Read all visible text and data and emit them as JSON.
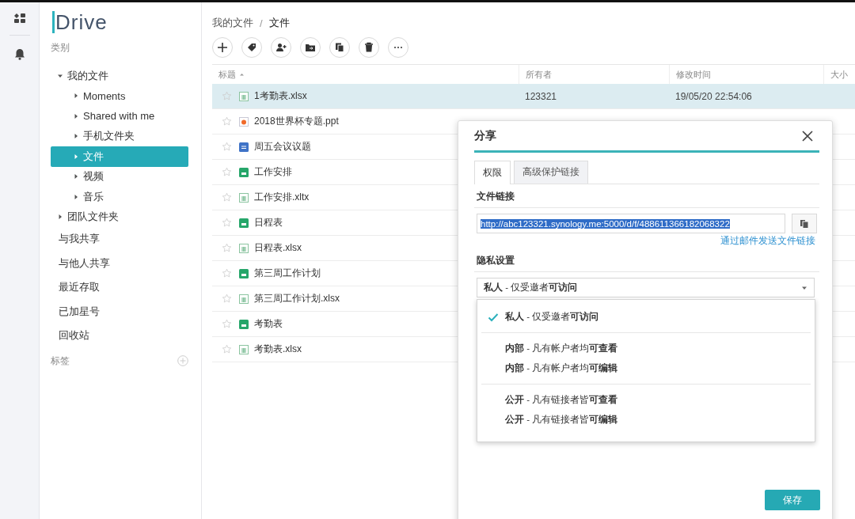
{
  "logo": {
    "text": "Drive"
  },
  "sidebar": {
    "section_label": "类别",
    "items": [
      {
        "label": "我的文件",
        "expanded": true,
        "selected": false,
        "children": [
          {
            "label": "Moments",
            "expanded": false,
            "selected": false
          },
          {
            "label": "Shared with me",
            "expanded": false,
            "selected": false
          },
          {
            "label": "手机文件夹",
            "expanded": false,
            "selected": false
          },
          {
            "label": "文件",
            "expanded": false,
            "selected": true
          },
          {
            "label": "视频",
            "expanded": false,
            "selected": false
          },
          {
            "label": "音乐",
            "expanded": false,
            "selected": false
          }
        ]
      },
      {
        "label": "团队文件夹",
        "expanded": false,
        "selected": false
      },
      {
        "label": "与我共享",
        "selected": false
      },
      {
        "label": "与他人共享",
        "selected": false
      },
      {
        "label": "最近存取",
        "selected": false
      },
      {
        "label": "已加星号",
        "selected": false
      },
      {
        "label": "回收站",
        "selected": false
      }
    ],
    "tags_label": "标签"
  },
  "breadcrumb": [
    "我的文件",
    "文件"
  ],
  "breadcrumb_separator": "/",
  "table": {
    "columns": [
      "标题",
      "所有者",
      "修改时间",
      "大小"
    ],
    "rows": [
      {
        "name": "1考勤表.xlsx",
        "kind": "xlsx",
        "selected": true,
        "owner": "123321",
        "modified": "19/05/20 22:54:06"
      },
      {
        "name": "2018世界杯专题.ppt",
        "kind": "ppt",
        "selected": false
      },
      {
        "name": "周五会议议题",
        "kind": "doc",
        "selected": false
      },
      {
        "name": "工作安排",
        "kind": "sheet",
        "selected": false
      },
      {
        "name": "工作安排.xltx",
        "kind": "xlsx",
        "selected": false
      },
      {
        "name": "日程表",
        "kind": "sheet",
        "selected": false
      },
      {
        "name": "日程表.xlsx",
        "kind": "xlsx",
        "selected": false
      },
      {
        "name": "第三周工作计划",
        "kind": "sheet",
        "selected": false
      },
      {
        "name": "第三周工作计划.xlsx",
        "kind": "xlsx",
        "selected": false
      },
      {
        "name": "考勤表",
        "kind": "sheet",
        "selected": false
      },
      {
        "name": "考勤表.xlsx",
        "kind": "xlsx",
        "selected": false
      }
    ]
  },
  "dialog": {
    "title": "分享",
    "tabs": [
      {
        "label": "权限",
        "selected": true
      },
      {
        "label": "高级保护链接",
        "selected": false
      }
    ],
    "link_label": "文件链接",
    "link_value": "http://abc123321.synology.me:5000/d/f/488611366182068322",
    "email_link": "通过邮件发送文件链接",
    "privacy_label": "隐私设置",
    "privacy_value": "**私人** - 仅受邀者**可访问**",
    "menu_groups": [
      {
        "options": [
          {
            "label": "**私人** - 仅受邀者**可访问**",
            "selected": true
          }
        ]
      },
      {
        "options": [
          {
            "label": "**内部** - 凡有帐户者均**可查看**",
            "selected": false
          },
          {
            "label": "**内部** - 凡有帐户者均**可编辑**",
            "selected": false
          }
        ]
      },
      {
        "options": [
          {
            "label": "**公开** - 凡有链接者皆**可查看**",
            "selected": false
          },
          {
            "label": "**公开** - 凡有链接者皆**可编辑**",
            "selected": false
          }
        ]
      }
    ],
    "save_button": "保存"
  }
}
